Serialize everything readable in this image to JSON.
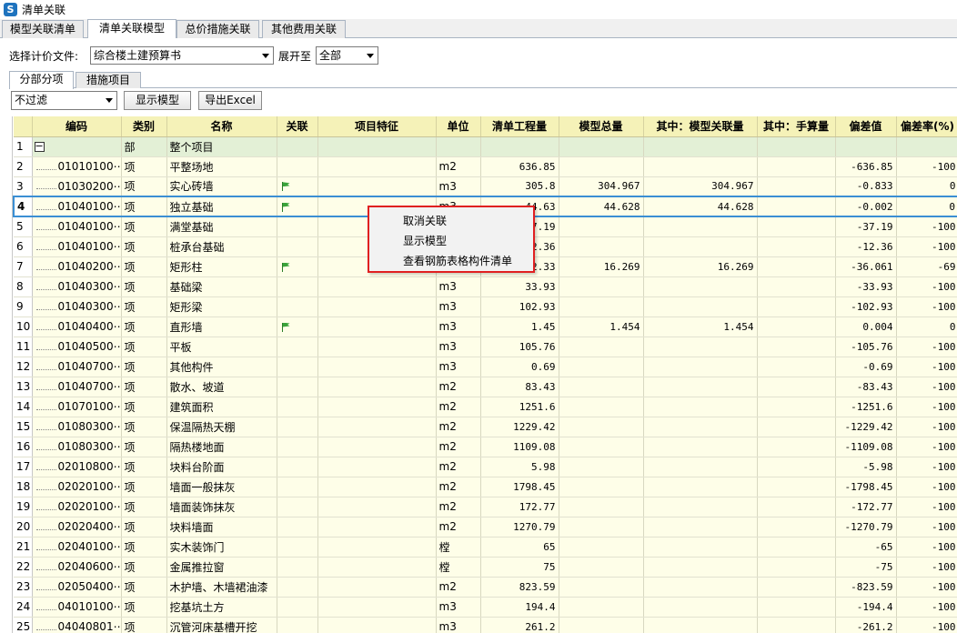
{
  "window": {
    "title": "清单关联",
    "icon_letter": "S"
  },
  "tabs": [
    {
      "label": "模型关联清单",
      "active": false
    },
    {
      "label": "清单关联模型",
      "active": true
    },
    {
      "label": "总价措施关联",
      "active": false
    },
    {
      "label": "其他费用关联",
      "active": false
    }
  ],
  "filebar": {
    "file_label": "选择计价文件:",
    "file_value": "综合楼土建预算书",
    "expand_label": "展开至",
    "expand_value": "全部"
  },
  "subtabs": [
    {
      "label": "分部分项",
      "active": true
    },
    {
      "label": "措施项目",
      "active": false
    }
  ],
  "toolbar": {
    "filter_value": "不过滤",
    "show_model_label": "显示模型",
    "export_label": "导出Excel"
  },
  "columns": [
    "",
    "编码",
    "类别",
    "名称",
    "关联",
    "项目特征",
    "单位",
    "清单工程量",
    "模型总量",
    "其中：模型关联量",
    "其中：手算量",
    "偏差值",
    "偏差率(%)"
  ],
  "rows": [
    {
      "n": "1",
      "code": "",
      "type": "部",
      "name": "整个项目",
      "linked": false,
      "unit": "",
      "qty": "",
      "model": "",
      "model_link": "",
      "manual": "",
      "dev": "",
      "rate": "",
      "group": true
    },
    {
      "n": "2",
      "code": "01010100⋯",
      "type": "项",
      "name": "平整场地",
      "linked": false,
      "unit": "m2",
      "qty": "636.85",
      "model": "",
      "model_link": "",
      "manual": "",
      "dev": "-636.85",
      "rate": "-100"
    },
    {
      "n": "3",
      "code": "01030200⋯",
      "type": "项",
      "name": "实心砖墙",
      "linked": true,
      "unit": "m3",
      "qty": "305.8",
      "model": "304.967",
      "model_link": "304.967",
      "manual": "",
      "dev": "-0.833",
      "rate": "0"
    },
    {
      "n": "4",
      "code": "01040100⋯",
      "type": "项",
      "name": "独立基础",
      "linked": true,
      "unit": "m3",
      "qty": "44.63",
      "model": "44.628",
      "model_link": "44.628",
      "manual": "",
      "dev": "-0.002",
      "rate": "0",
      "selected": true
    },
    {
      "n": "5",
      "code": "01040100⋯",
      "type": "项",
      "name": "满堂基础",
      "linked": false,
      "unit": "m3",
      "qty": "37.19",
      "model": "",
      "model_link": "",
      "manual": "",
      "dev": "-37.19",
      "rate": "-100"
    },
    {
      "n": "6",
      "code": "01040100⋯",
      "type": "项",
      "name": "桩承台基础",
      "linked": false,
      "unit": "m3",
      "qty": "12.36",
      "model": "",
      "model_link": "",
      "manual": "",
      "dev": "-12.36",
      "rate": "-100"
    },
    {
      "n": "7",
      "code": "01040200⋯",
      "type": "项",
      "name": "矩形柱",
      "linked": true,
      "unit": "m3",
      "qty": "52.33",
      "model": "16.269",
      "model_link": "16.269",
      "manual": "",
      "dev": "-36.061",
      "rate": "-69"
    },
    {
      "n": "8",
      "code": "01040300⋯",
      "type": "项",
      "name": "基础梁",
      "linked": false,
      "unit": "m3",
      "qty": "33.93",
      "model": "",
      "model_link": "",
      "manual": "",
      "dev": "-33.93",
      "rate": "-100"
    },
    {
      "n": "9",
      "code": "01040300⋯",
      "type": "项",
      "name": "矩形梁",
      "linked": false,
      "unit": "m3",
      "qty": "102.93",
      "model": "",
      "model_link": "",
      "manual": "",
      "dev": "-102.93",
      "rate": "-100"
    },
    {
      "n": "10",
      "code": "01040400⋯",
      "type": "项",
      "name": "直形墙",
      "linked": true,
      "unit": "m3",
      "qty": "1.45",
      "model": "1.454",
      "model_link": "1.454",
      "manual": "",
      "dev": "0.004",
      "rate": "0"
    },
    {
      "n": "11",
      "code": "01040500⋯",
      "type": "项",
      "name": "平板",
      "linked": false,
      "unit": "m3",
      "qty": "105.76",
      "model": "",
      "model_link": "",
      "manual": "",
      "dev": "-105.76",
      "rate": "-100"
    },
    {
      "n": "12",
      "code": "01040700⋯",
      "type": "项",
      "name": "其他构件",
      "linked": false,
      "unit": "m3",
      "qty": "0.69",
      "model": "",
      "model_link": "",
      "manual": "",
      "dev": "-0.69",
      "rate": "-100"
    },
    {
      "n": "13",
      "code": "01040700⋯",
      "type": "项",
      "name": "散水、坡道",
      "linked": false,
      "unit": "m2",
      "qty": "83.43",
      "model": "",
      "model_link": "",
      "manual": "",
      "dev": "-83.43",
      "rate": "-100"
    },
    {
      "n": "14",
      "code": "01070100⋯",
      "type": "项",
      "name": "建筑面积",
      "linked": false,
      "unit": "m2",
      "qty": "1251.6",
      "model": "",
      "model_link": "",
      "manual": "",
      "dev": "-1251.6",
      "rate": "-100"
    },
    {
      "n": "15",
      "code": "01080300⋯",
      "type": "项",
      "name": "保温隔热天棚",
      "linked": false,
      "unit": "m2",
      "qty": "1229.42",
      "model": "",
      "model_link": "",
      "manual": "",
      "dev": "-1229.42",
      "rate": "-100"
    },
    {
      "n": "16",
      "code": "01080300⋯",
      "type": "项",
      "name": "隔热楼地面",
      "linked": false,
      "unit": "m2",
      "qty": "1109.08",
      "model": "",
      "model_link": "",
      "manual": "",
      "dev": "-1109.08",
      "rate": "-100"
    },
    {
      "n": "17",
      "code": "02010800⋯",
      "type": "项",
      "name": "块料台阶面",
      "linked": false,
      "unit": "m2",
      "qty": "5.98",
      "model": "",
      "model_link": "",
      "manual": "",
      "dev": "-5.98",
      "rate": "-100"
    },
    {
      "n": "18",
      "code": "02020100⋯",
      "type": "项",
      "name": "墙面一般抹灰",
      "linked": false,
      "unit": "m2",
      "qty": "1798.45",
      "model": "",
      "model_link": "",
      "manual": "",
      "dev": "-1798.45",
      "rate": "-100"
    },
    {
      "n": "19",
      "code": "02020100⋯",
      "type": "项",
      "name": "墙面装饰抹灰",
      "linked": false,
      "unit": "m2",
      "qty": "172.77",
      "model": "",
      "model_link": "",
      "manual": "",
      "dev": "-172.77",
      "rate": "-100"
    },
    {
      "n": "20",
      "code": "02020400⋯",
      "type": "项",
      "name": "块料墙面",
      "linked": false,
      "unit": "m2",
      "qty": "1270.79",
      "model": "",
      "model_link": "",
      "manual": "",
      "dev": "-1270.79",
      "rate": "-100"
    },
    {
      "n": "21",
      "code": "02040100⋯",
      "type": "项",
      "name": "实木装饰门",
      "linked": false,
      "unit": "樘",
      "qty": "65",
      "model": "",
      "model_link": "",
      "manual": "",
      "dev": "-65",
      "rate": "-100"
    },
    {
      "n": "22",
      "code": "02040600⋯",
      "type": "项",
      "name": "金属推拉窗",
      "linked": false,
      "unit": "樘",
      "qty": "75",
      "model": "",
      "model_link": "",
      "manual": "",
      "dev": "-75",
      "rate": "-100"
    },
    {
      "n": "23",
      "code": "02050400⋯",
      "type": "项",
      "name": "木护墙、木墙裙油漆",
      "linked": false,
      "unit": "m2",
      "qty": "823.59",
      "model": "",
      "model_link": "",
      "manual": "",
      "dev": "-823.59",
      "rate": "-100"
    },
    {
      "n": "24",
      "code": "04010100⋯",
      "type": "项",
      "name": "挖基坑土方",
      "linked": false,
      "unit": "m3",
      "qty": "194.4",
      "model": "",
      "model_link": "",
      "manual": "",
      "dev": "-194.4",
      "rate": "-100"
    },
    {
      "n": "25",
      "code": "04040801⋯",
      "type": "项",
      "name": "沉管河床基槽开挖",
      "linked": false,
      "unit": "m3",
      "qty": "261.2",
      "model": "",
      "model_link": "",
      "manual": "",
      "dev": "-261.2",
      "rate": "-100"
    }
  ],
  "context_menu": [
    "取消关联",
    "显示模型",
    "查看钢筋表格构件清单"
  ],
  "colors": {
    "header": "#f5f2b8",
    "cell": "#fefee8",
    "group": "#e3f0d6",
    "selection": "#3b8fd4",
    "menu_border": "#e02020"
  }
}
